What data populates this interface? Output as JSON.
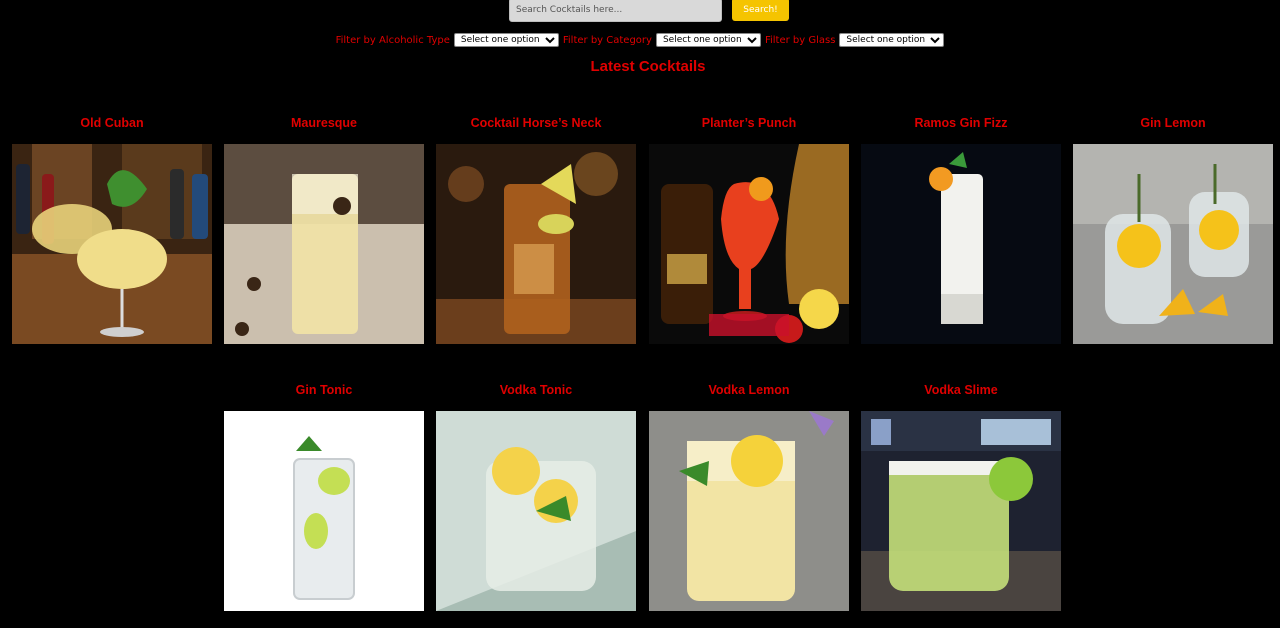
{
  "search": {
    "placeholder": "Search Cocktails here...",
    "button_label": "Search!"
  },
  "filters": {
    "alcoholic": {
      "label": "Filter by Alcoholic Type",
      "selected": "Select one option"
    },
    "category": {
      "label": "Filter by Category",
      "selected": "Select one option"
    },
    "glass": {
      "label": "Filter by Glass",
      "selected": "Select one option"
    }
  },
  "section": {
    "title": "Latest Cocktails"
  },
  "colors": {
    "accent_red": "#e00000",
    "button_yellow": "#f5c400",
    "background": "#000000"
  },
  "cocktails": [
    {
      "name": "Old Cuban",
      "image": "old-cuban-photo"
    },
    {
      "name": "Mauresque",
      "image": "mauresque-photo"
    },
    {
      "name": "Cocktail Horse’s Neck",
      "image": "horses-neck-photo"
    },
    {
      "name": "Planter’s Punch",
      "image": "planters-punch-photo"
    },
    {
      "name": "Ramos Gin Fizz",
      "image": "ramos-gin-fizz-photo"
    },
    {
      "name": "Gin Lemon",
      "image": "gin-lemon-photo"
    },
    {
      "name": "Gin Tonic",
      "image": "gin-tonic-photo"
    },
    {
      "name": "Vodka Tonic",
      "image": "vodka-tonic-photo"
    },
    {
      "name": "Vodka Lemon",
      "image": "vodka-lemon-photo"
    },
    {
      "name": "Vodka Slime",
      "image": "vodka-slime-photo"
    }
  ]
}
